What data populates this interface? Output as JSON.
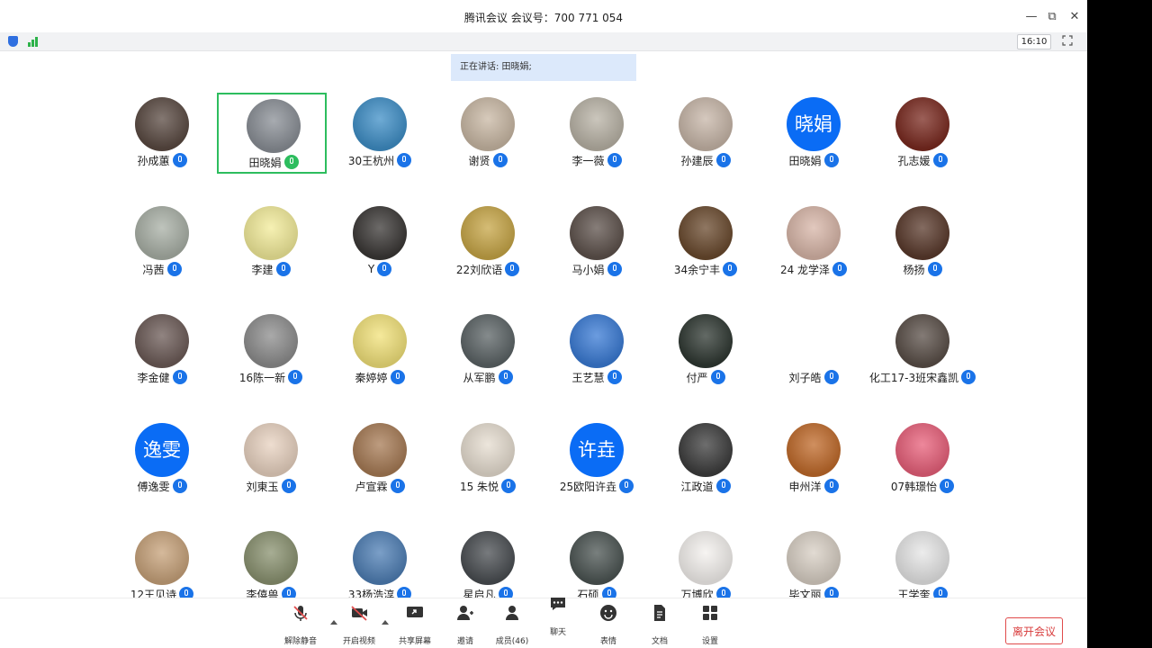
{
  "window": {
    "title": "腾讯会议 会议号：700 771 054"
  },
  "infobar": {
    "time": "16:10"
  },
  "speaking": {
    "text": "正在讲话: 田晓娟;"
  },
  "participants": [
    {
      "name": "孙成蕙",
      "avatar": "photo",
      "color": "#5a4a42"
    },
    {
      "name": "田晓娟",
      "avatar": "photo",
      "color": "#8a8f96",
      "active": true,
      "speaking": true
    },
    {
      "name": "30王杭州",
      "avatar": "photo",
      "color": "#3f8fc7"
    },
    {
      "name": "谢贤",
      "avatar": "photo",
      "color": "#c9b8a4"
    },
    {
      "name": "李一薇",
      "avatar": "photo",
      "color": "#b9b3a6"
    },
    {
      "name": "孙建辰",
      "avatar": "photo",
      "color": "#c7b6a8"
    },
    {
      "name": "田晓娟",
      "avatar": "text",
      "avatar_text": "晓娟",
      "color": "#0a6cf5"
    },
    {
      "name": "孔志媛",
      "avatar": "photo",
      "color": "#7a2a20"
    },
    {
      "name": "冯茜",
      "avatar": "photo",
      "color": "#a9b0a6"
    },
    {
      "name": "李建",
      "avatar": "photo",
      "color": "#f3ec9a"
    },
    {
      "name": "Y",
      "avatar": "photo",
      "color": "#3b3836"
    },
    {
      "name": "22刘欣语",
      "avatar": "photo",
      "color": "#c7a647"
    },
    {
      "name": "马小娟",
      "avatar": "photo",
      "color": "#5e524c"
    },
    {
      "name": "34余宁丰",
      "avatar": "photo",
      "color": "#6a4a2e"
    },
    {
      "name": "24 龙学泽",
      "avatar": "photo",
      "color": "#d8b6a8"
    },
    {
      "name": "杨扬",
      "avatar": "photo",
      "color": "#5a3a2c"
    },
    {
      "name": "李金健",
      "avatar": "photo",
      "color": "#6c5b57"
    },
    {
      "name": "16陈一新",
      "avatar": "photo",
      "color": "#8d8d8d"
    },
    {
      "name": "秦婷婷",
      "avatar": "photo",
      "color": "#f2e27a"
    },
    {
      "name": "从军鹏",
      "avatar": "photo",
      "color": "#5c6466"
    },
    {
      "name": "王艺慧",
      "avatar": "photo",
      "color": "#3a7bd5"
    },
    {
      "name": "付严",
      "avatar": "photo",
      "color": "#2f3832"
    },
    {
      "name": "刘子皓",
      "avatar": "photo",
      "color": "#ffffff"
    },
    {
      "name": "化工17-3班宋鑫凯",
      "avatar": "photo",
      "color": "#5a4f48"
    },
    {
      "name": "傅逸雯",
      "avatar": "text",
      "avatar_text": "逸雯",
      "color": "#0a6cf5"
    },
    {
      "name": "刘東玉",
      "avatar": "photo",
      "color": "#e8d2c0"
    },
    {
      "name": "卢宣霖",
      "avatar": "photo",
      "color": "#a77b55"
    },
    {
      "name": "15 朱悦",
      "avatar": "photo",
      "color": "#e6ddd0"
    },
    {
      "name": "25欧阳许垚",
      "avatar": "text",
      "avatar_text": "许垚",
      "color": "#0a6cf5"
    },
    {
      "name": "江政道",
      "avatar": "photo",
      "color": "#3d3d3d"
    },
    {
      "name": "申州洋",
      "avatar": "photo",
      "color": "#c06a2a"
    },
    {
      "name": "07韩璟怡",
      "avatar": "photo",
      "color": "#e8607a"
    },
    {
      "name": "12王见诗",
      "avatar": "photo",
      "color": "#c7a27a"
    },
    {
      "name": "李僖兽",
      "avatar": "photo",
      "color": "#8a9270"
    },
    {
      "name": "33杨浩淳",
      "avatar": "photo",
      "color": "#4f7fb5"
    },
    {
      "name": "星启凡",
      "avatar": "photo",
      "color": "#4a4e52"
    },
    {
      "name": "石硕",
      "avatar": "photo",
      "color": "#4c5553"
    },
    {
      "name": "万博欣",
      "avatar": "photo",
      "color": "#f4f1ee"
    },
    {
      "name": "毕文丽",
      "avatar": "photo",
      "color": "#d8cfc4"
    },
    {
      "name": "王学奎",
      "avatar": "photo",
      "color": "#e6e6e6"
    }
  ],
  "toolbar": {
    "unmute": "解除静音",
    "start_video": "开启视频",
    "share_screen": "共享屏幕",
    "invite": "邀请",
    "members": "成员(46)",
    "chat": "聊天",
    "emoji": "表情",
    "docs": "文档",
    "settings": "设置",
    "leave": "离开会议"
  }
}
